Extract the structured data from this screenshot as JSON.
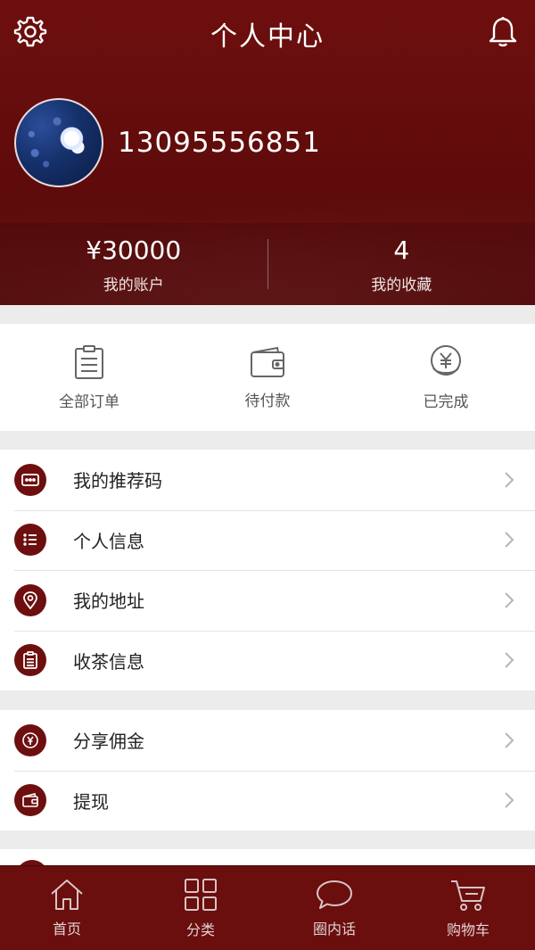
{
  "header": {
    "title": "个人中心",
    "phone": "13095556851",
    "balance": "¥30000",
    "balance_label": "我的账户",
    "favorites": "4",
    "favorites_label": "我的收藏"
  },
  "orders": [
    {
      "label": "全部订单",
      "icon": "clipboard-icon"
    },
    {
      "label": "待付款",
      "icon": "wallet-icon"
    },
    {
      "label": "已完成",
      "icon": "yen-coin-icon"
    }
  ],
  "menu_group_1": [
    {
      "label": "我的推荐码",
      "icon": "message-dots-icon"
    },
    {
      "label": "个人信息",
      "icon": "list-icon"
    },
    {
      "label": "我的地址",
      "icon": "location-pin-icon"
    },
    {
      "label": "收茶信息",
      "icon": "clipboard-icon"
    }
  ],
  "menu_group_2": [
    {
      "label": "分享佣金",
      "icon": "yen-coin-icon"
    },
    {
      "label": "提现",
      "icon": "wallet-icon"
    }
  ],
  "tabbar": [
    {
      "label": "首页",
      "icon": "home-icon"
    },
    {
      "label": "分类",
      "icon": "grid-icon"
    },
    {
      "label": "圈内话",
      "icon": "chat-bubble-icon"
    },
    {
      "label": "购物车",
      "icon": "cart-icon"
    }
  ],
  "colors": {
    "brand": "#6e0f0f",
    "background": "#ececec"
  }
}
